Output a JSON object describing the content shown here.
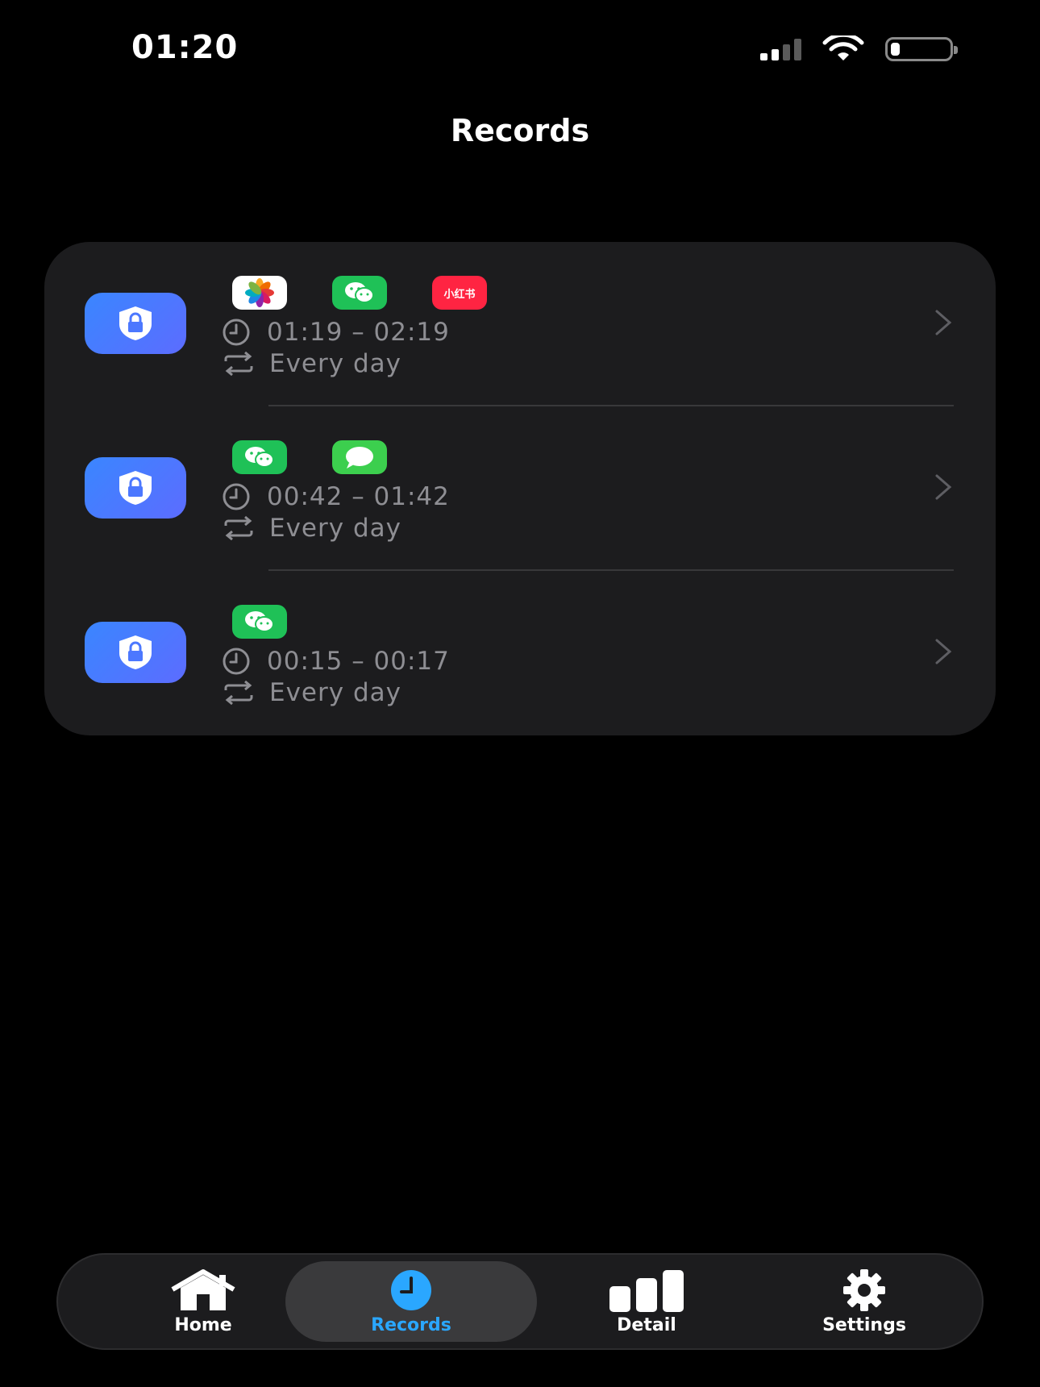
{
  "status_bar": {
    "time": "01:20",
    "battery_level": 0.15
  },
  "header": {
    "title": "Records"
  },
  "records": [
    {
      "apps": [
        "photos-icon",
        "wechat-icon",
        "xiaohongshu-icon"
      ],
      "xhs_label": "小红书",
      "time_range": "01:19 – 02:19",
      "repeat": "Every day"
    },
    {
      "apps": [
        "wechat-icon",
        "messages-icon"
      ],
      "time_range": "00:42 – 01:42",
      "repeat": "Every day"
    },
    {
      "apps": [
        "wechat-icon"
      ],
      "time_range": "00:15 – 00:17",
      "repeat": "Every day"
    }
  ],
  "tab_bar": {
    "tabs": [
      {
        "label": "Home",
        "icon": "house-icon"
      },
      {
        "label": "Records",
        "icon": "clock-icon",
        "active": true
      },
      {
        "label": "Detail",
        "icon": "bar-chart-icon"
      },
      {
        "label": "Settings",
        "icon": "gear-icon"
      }
    ]
  },
  "colors": {
    "background": "#000000",
    "card": "#1c1c1e",
    "accent": "#2aa7ff",
    "secondary_text": "#8e8e93",
    "lock_badge_start": "#3a86ff",
    "lock_badge_end": "#5c6cff"
  }
}
